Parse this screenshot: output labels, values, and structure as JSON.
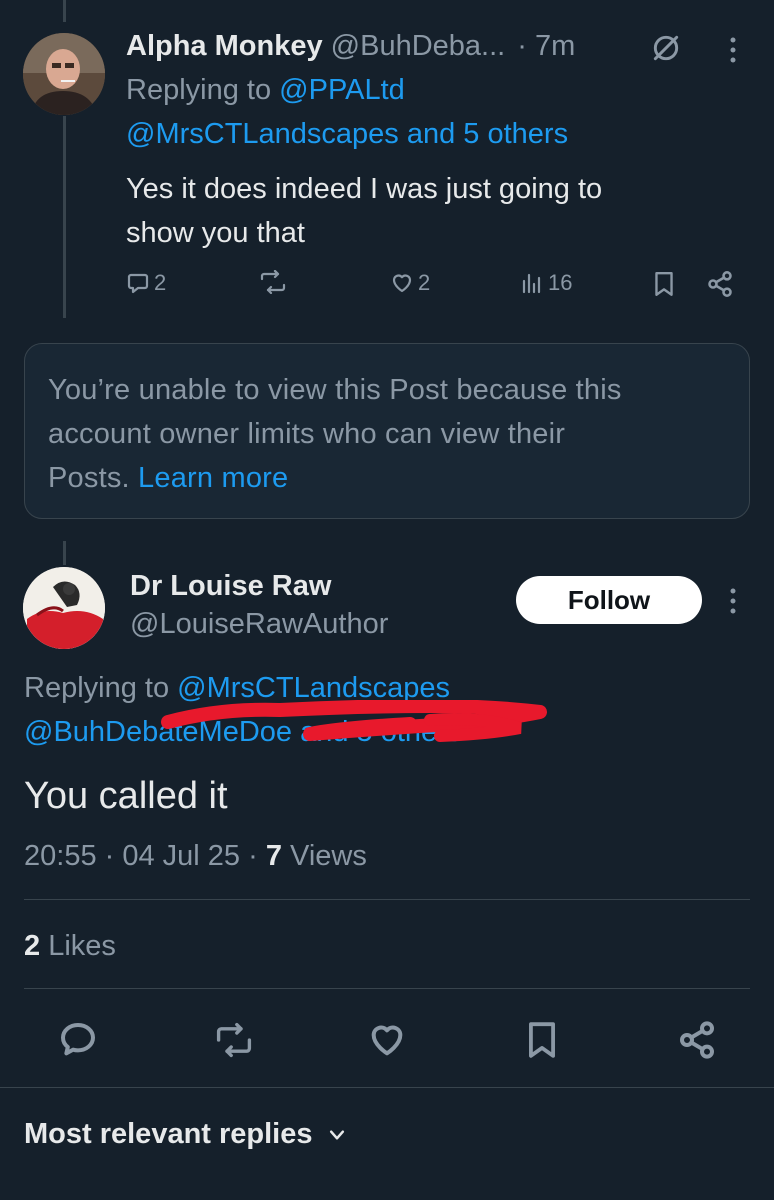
{
  "reply_tweet": {
    "display_name": "Alpha Monkey",
    "handle": "@BuhDeba...",
    "time": "· 7m",
    "replying_prefix": "Replying to ",
    "replying_to_first": "@PPALtd",
    "replying_to_rest": "@MrsCTLandscapes and 5 others",
    "text_line1": "Yes it does indeed I was just going to",
    "text_line2": "show you that",
    "replies": "2",
    "likes": "2",
    "views": "16"
  },
  "limited_notice": {
    "line1": "You’re unable to view this Post because this",
    "line2": "account owner limits who can view their",
    "line3_prefix": "Posts. ",
    "learn_more": "Learn more"
  },
  "main_tweet": {
    "display_name": "Dr Louise Raw",
    "handle": "@LouiseRawAuthor",
    "follow_label": "Follow",
    "replying_prefix": "Replying to ",
    "replying_to_first": "@MrsCTLandscapes",
    "replying_to_rest": "@BuhDebateMeDoe and 5 others",
    "text": "You called it",
    "time": "20:55 · 04 Jul 25 · ",
    "views_count": "7",
    "views_label": " Views",
    "likes_count": "2",
    "likes_label": " Likes"
  },
  "replies_header": {
    "label": "Most relevant replies"
  },
  "colors": {
    "background": "#15202b",
    "link": "#1d9bf0",
    "muted": "#8b98a5",
    "annotation": "#e8192c"
  }
}
